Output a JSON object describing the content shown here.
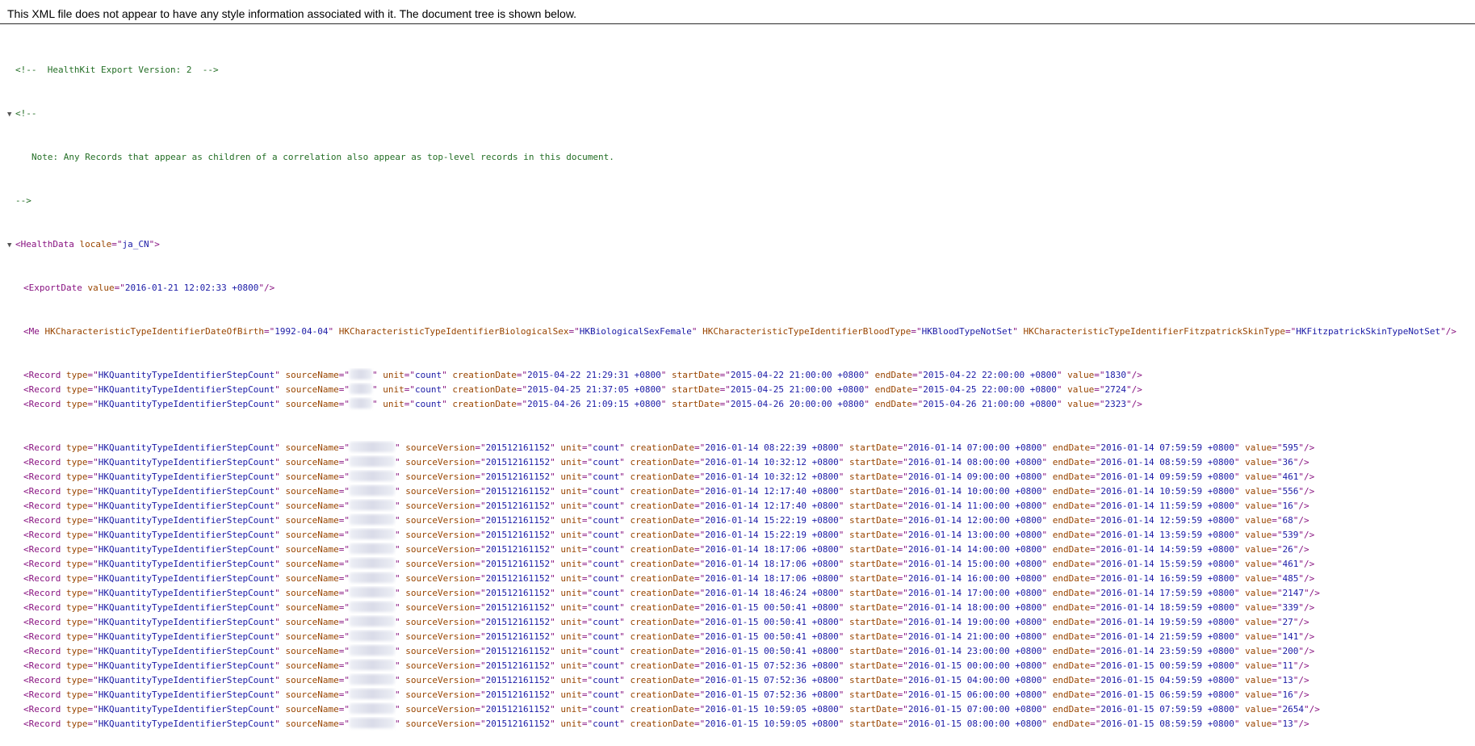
{
  "banner": "This XML file does not appear to have any style information associated with it. The document tree is shown below.",
  "comment_version": "<!--  HealthKit Export Version: 2  -->",
  "comment_open": "<!--",
  "comment_note": "Note: Any Records that appear as children of a correlation also appear as top-level records in this document.",
  "comment_close": "-->",
  "health_data": {
    "tag": "HealthData",
    "attr": "locale",
    "value": "ja_CN"
  },
  "export_date": {
    "tag": "ExportDate",
    "attr": "value",
    "value": "2016-01-21 12:02:33 +0800"
  },
  "me": {
    "tag": "Me",
    "attrs": [
      {
        "name": "HKCharacteristicTypeIdentifierDateOfBirth",
        "value": "1992-04-04"
      },
      {
        "name": "HKCharacteristicTypeIdentifierBiologicalSex",
        "value": "HKBiologicalSexFemale"
      },
      {
        "name": "HKCharacteristicTypeIdentifierBloodType",
        "value": "HKBloodTypeNotSet"
      },
      {
        "name": "HKCharacteristicTypeIdentifierFitzpatrickSkinType",
        "value": "HKFitzpatrickSkinTypeNotSet"
      }
    ]
  },
  "record_common": {
    "tag": "Record",
    "type": "HKQuantityTypeIdentifierStepCount",
    "unit": "count",
    "source_version": "201512161152"
  },
  "records_short": [
    {
      "creationDate": "2015-04-22 21:29:31 +0800",
      "startDate": "2015-04-22 21:00:00 +0800",
      "endDate": "2015-04-22 22:00:00 +0800",
      "value": "1830"
    },
    {
      "creationDate": "2015-04-25 21:37:05 +0800",
      "startDate": "2015-04-25 21:00:00 +0800",
      "endDate": "2015-04-25 22:00:00 +0800",
      "value": "2724"
    },
    {
      "creationDate": "2015-04-26 21:09:15 +0800",
      "startDate": "2015-04-26 20:00:00 +0800",
      "endDate": "2015-04-26 21:00:00 +0800",
      "value": "2323"
    }
  ],
  "records_long": [
    {
      "creationDate": "2016-01-14 08:22:39 +0800",
      "startDate": "2016-01-14 07:00:00 +0800",
      "endDate": "2016-01-14 07:59:59 +0800",
      "value": "595"
    },
    {
      "creationDate": "2016-01-14 10:32:12 +0800",
      "startDate": "2016-01-14 08:00:00 +0800",
      "endDate": "2016-01-14 08:59:59 +0800",
      "value": "36"
    },
    {
      "creationDate": "2016-01-14 10:32:12 +0800",
      "startDate": "2016-01-14 09:00:00 +0800",
      "endDate": "2016-01-14 09:59:59 +0800",
      "value": "461"
    },
    {
      "creationDate": "2016-01-14 12:17:40 +0800",
      "startDate": "2016-01-14 10:00:00 +0800",
      "endDate": "2016-01-14 10:59:59 +0800",
      "value": "556"
    },
    {
      "creationDate": "2016-01-14 12:17:40 +0800",
      "startDate": "2016-01-14 11:00:00 +0800",
      "endDate": "2016-01-14 11:59:59 +0800",
      "value": "16"
    },
    {
      "creationDate": "2016-01-14 15:22:19 +0800",
      "startDate": "2016-01-14 12:00:00 +0800",
      "endDate": "2016-01-14 12:59:59 +0800",
      "value": "68"
    },
    {
      "creationDate": "2016-01-14 15:22:19 +0800",
      "startDate": "2016-01-14 13:00:00 +0800",
      "endDate": "2016-01-14 13:59:59 +0800",
      "value": "539"
    },
    {
      "creationDate": "2016-01-14 18:17:06 +0800",
      "startDate": "2016-01-14 14:00:00 +0800",
      "endDate": "2016-01-14 14:59:59 +0800",
      "value": "26"
    },
    {
      "creationDate": "2016-01-14 18:17:06 +0800",
      "startDate": "2016-01-14 15:00:00 +0800",
      "endDate": "2016-01-14 15:59:59 +0800",
      "value": "461"
    },
    {
      "creationDate": "2016-01-14 18:17:06 +0800",
      "startDate": "2016-01-14 16:00:00 +0800",
      "endDate": "2016-01-14 16:59:59 +0800",
      "value": "485"
    },
    {
      "creationDate": "2016-01-14 18:46:24 +0800",
      "startDate": "2016-01-14 17:00:00 +0800",
      "endDate": "2016-01-14 17:59:59 +0800",
      "value": "2147"
    },
    {
      "creationDate": "2016-01-15 00:50:41 +0800",
      "startDate": "2016-01-14 18:00:00 +0800",
      "endDate": "2016-01-14 18:59:59 +0800",
      "value": "339"
    },
    {
      "creationDate": "2016-01-15 00:50:41 +0800",
      "startDate": "2016-01-14 19:00:00 +0800",
      "endDate": "2016-01-14 19:59:59 +0800",
      "value": "27"
    },
    {
      "creationDate": "2016-01-15 00:50:41 +0800",
      "startDate": "2016-01-14 21:00:00 +0800",
      "endDate": "2016-01-14 21:59:59 +0800",
      "value": "141"
    },
    {
      "creationDate": "2016-01-15 00:50:41 +0800",
      "startDate": "2016-01-14 23:00:00 +0800",
      "endDate": "2016-01-14 23:59:59 +0800",
      "value": "200"
    },
    {
      "creationDate": "2016-01-15 07:52:36 +0800",
      "startDate": "2016-01-15 00:00:00 +0800",
      "endDate": "2016-01-15 00:59:59 +0800",
      "value": "11"
    },
    {
      "creationDate": "2016-01-15 07:52:36 +0800",
      "startDate": "2016-01-15 04:00:00 +0800",
      "endDate": "2016-01-15 04:59:59 +0800",
      "value": "13"
    },
    {
      "creationDate": "2016-01-15 07:52:36 +0800",
      "startDate": "2016-01-15 06:00:00 +0800",
      "endDate": "2016-01-15 06:59:59 +0800",
      "value": "16"
    },
    {
      "creationDate": "2016-01-15 10:59:05 +0800",
      "startDate": "2016-01-15 07:00:00 +0800",
      "endDate": "2016-01-15 07:59:59 +0800",
      "value": "2654"
    },
    {
      "creationDate": "2016-01-15 10:59:05 +0800",
      "startDate": "2016-01-15 08:00:00 +0800",
      "endDate": "2016-01-15 08:59:59 +0800",
      "value": "13"
    }
  ]
}
